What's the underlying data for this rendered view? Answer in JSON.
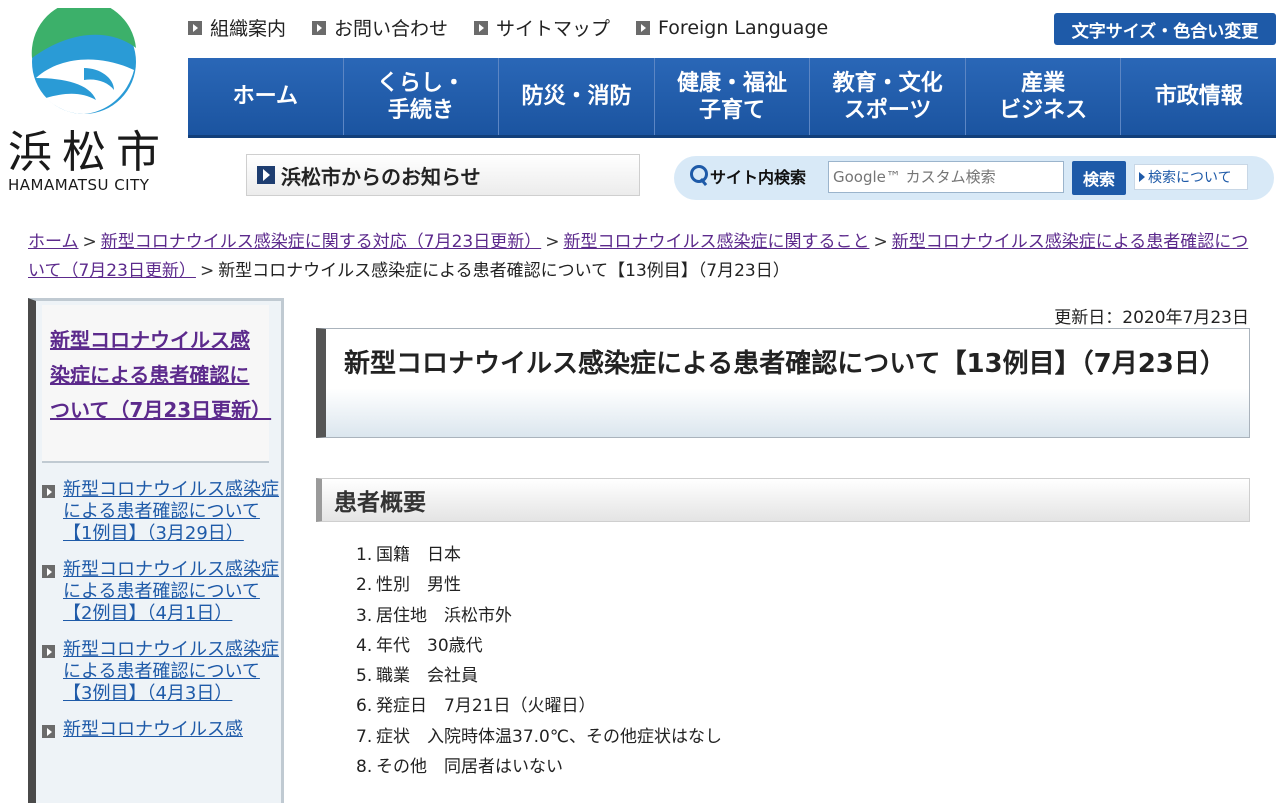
{
  "header": {
    "logo_kanji": "浜松市",
    "logo_en": "HAMAMATSU CITY",
    "utility_links": [
      "組織案内",
      "お問い合わせ",
      "サイトマップ",
      "Foreign Language"
    ],
    "font_size_button": "文字サイズ・色合い変更",
    "nav": [
      "ホーム",
      "くらし・\n手続き",
      "防災・消防",
      "健康・福祉\n子育て",
      "教育・文化\nスポーツ",
      "産業\nビジネス",
      "市政情報"
    ],
    "news_label": "浜松市からのお知らせ",
    "search": {
      "label": "サイト内検索",
      "placeholder": "Google™ カスタム検索",
      "button": "検索",
      "about": "検索について"
    }
  },
  "breadcrumb": {
    "items": [
      "ホーム",
      "新型コロナウイルス感染症に関する対応（7月23日更新）",
      "新型コロナウイルス感染症に関すること",
      "新型コロナウイルス感染症による患者確認について（7月23日更新）"
    ],
    "current": "新型コロナウイルス感染症による患者確認について【13例目】（7月23日）",
    "separator": ">"
  },
  "sidebar": {
    "heading": "新型コロナウイルス感染症による患者確認について（7月23日更新）",
    "items": [
      "新型コロナウイルス感染症による患者確認について【1例目】（3月29日）",
      "新型コロナウイルス感染症による患者確認について【2例目】（4月1日）",
      "新型コロナウイルス感染症による患者確認について【3例目】（4月3日）",
      "新型コロナウイルス感"
    ]
  },
  "main": {
    "updated": "更新日：2020年7月23日",
    "title": "新型コロナウイルス感染症による患者確認について【13例目】（7月23日）",
    "section": "患者概要",
    "facts": [
      "国籍　日本",
      "性別　男性",
      "居住地　浜松市外",
      "年代　30歳代",
      "職業　会社員",
      "発症日　7月21日（火曜日）",
      "症状　入院時体温37.0℃、その他症状はなし",
      "その他　同居者はいない"
    ]
  },
  "colors": {
    "nav_blue": "#1e5aa8",
    "visited_link": "#5c2a8c",
    "link": "#1e5aa8"
  }
}
